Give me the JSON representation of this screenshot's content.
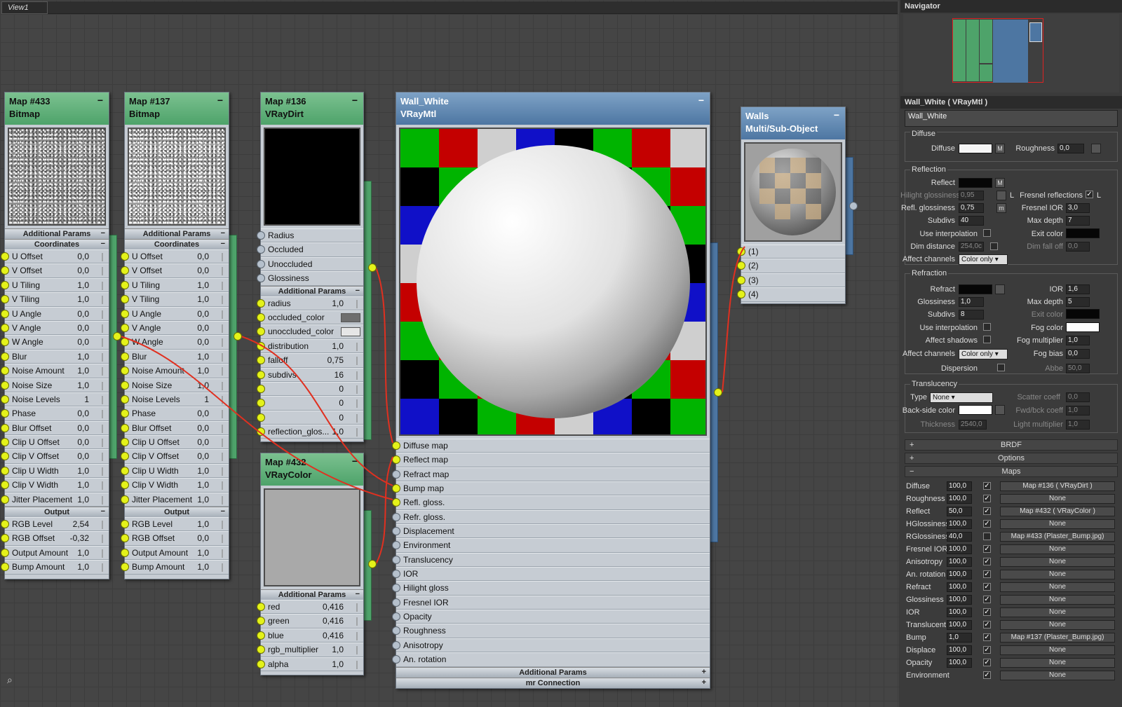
{
  "view": {
    "tab": "View1"
  },
  "nodes": {
    "n433": {
      "title": "Map #433",
      "type": "Bitmap",
      "sec1": "Additional Params",
      "sec2": "Coordinates",
      "sec3": "Output",
      "coords": [
        [
          "U Offset",
          "0,0"
        ],
        [
          "V Offset",
          "0,0"
        ],
        [
          "U Tiling",
          "1,0"
        ],
        [
          "V Tiling",
          "1,0"
        ],
        [
          "U Angle",
          "0,0"
        ],
        [
          "V Angle",
          "0,0"
        ],
        [
          "W Angle",
          "0,0"
        ],
        [
          "Blur",
          "1,0"
        ],
        [
          "Noise Amount",
          "1,0"
        ],
        [
          "Noise Size",
          "1,0"
        ],
        [
          "Noise Levels",
          "1"
        ],
        [
          "Phase",
          "0,0"
        ],
        [
          "Blur Offset",
          "0,0"
        ],
        [
          "Clip U Offset",
          "0,0"
        ],
        [
          "Clip V Offset",
          "0,0"
        ],
        [
          "Clip U Width",
          "1,0"
        ],
        [
          "Clip V Width",
          "1,0"
        ],
        [
          "Jitter Placement",
          "1,0"
        ]
      ],
      "output": [
        [
          "RGB Level",
          "2,54"
        ],
        [
          "RGB Offset",
          "-0,32"
        ],
        [
          "Output Amount",
          "1,0"
        ],
        [
          "Bump Amount",
          "1,0"
        ]
      ]
    },
    "n137": {
      "title": "Map #137",
      "type": "Bitmap",
      "sec1": "Additional Params",
      "sec2": "Coordinates",
      "sec3": "Output",
      "coords": [
        [
          "U Offset",
          "0,0"
        ],
        [
          "V Offset",
          "0,0"
        ],
        [
          "U Tiling",
          "1,0"
        ],
        [
          "V Tiling",
          "1,0"
        ],
        [
          "U Angle",
          "0,0"
        ],
        [
          "V Angle",
          "0,0"
        ],
        [
          "W Angle",
          "0,0"
        ],
        [
          "Blur",
          "1,0"
        ],
        [
          "Noise Amount",
          "1,0"
        ],
        [
          "Noise Size",
          "1,0"
        ],
        [
          "Noise Levels",
          "1"
        ],
        [
          "Phase",
          "0,0"
        ],
        [
          "Blur Offset",
          "0,0"
        ],
        [
          "Clip U Offset",
          "0,0"
        ],
        [
          "Clip V Offset",
          "0,0"
        ],
        [
          "Clip U Width",
          "1,0"
        ],
        [
          "Clip V Width",
          "1,0"
        ],
        [
          "Jitter Placement",
          "1,0"
        ]
      ],
      "output": [
        [
          "RGB Level",
          "1,0"
        ],
        [
          "RGB Offset",
          "0,0"
        ],
        [
          "Output Amount",
          "1,0"
        ],
        [
          "Bump Amount",
          "1,0"
        ]
      ]
    },
    "n136": {
      "title": "Map #136",
      "type": "VRayDirt",
      "inputs": [
        "Radius",
        "Occluded",
        "Unoccluded",
        "Glossiness"
      ],
      "sec1": "Additional Params",
      "params": [
        [
          "radius",
          "1,0"
        ],
        [
          "occluded_color",
          ""
        ],
        [
          "unoccluded_color",
          ""
        ],
        [
          "distribution",
          "1,0"
        ],
        [
          "falloff",
          "0,75"
        ],
        [
          "subdivs",
          "16"
        ],
        [
          "",
          "0"
        ],
        [
          "",
          "0"
        ],
        [
          "",
          "0"
        ],
        [
          "reflection_glos...",
          "1,0"
        ]
      ]
    },
    "n432": {
      "title": "Map #432",
      "type": "VRayColor",
      "sec1": "Additional Params",
      "params": [
        [
          "red",
          "0,416"
        ],
        [
          "green",
          "0,416"
        ],
        [
          "blue",
          "0,416"
        ],
        [
          "rgb_multiplier",
          "1,0"
        ],
        [
          "alpha",
          "1,0"
        ]
      ]
    },
    "wall": {
      "title": "Wall_White",
      "type": "VRayMtl",
      "slots": [
        "Diffuse map",
        "Reflect map",
        "Refract map",
        "Bump map",
        "Refl. gloss.",
        "Refr. gloss.",
        "Displacement",
        "Environment",
        "Translucency",
        "IOR",
        "Hilight gloss",
        "Fresnel IOR",
        "Opacity",
        "Roughness",
        "Anisotropy",
        "An. rotation"
      ],
      "sec1": "Additional Params",
      "sec2": "mr Connection"
    },
    "walls": {
      "title": "Walls",
      "type": "Multi/Sub-Object",
      "slots": [
        "(1)",
        "(2)",
        "(3)",
        "(4)"
      ]
    }
  },
  "navigator": {
    "title": "Navigator"
  },
  "material": {
    "header": "Wall_White  ( VRayMtl )",
    "name": "Wall_White",
    "diffuse": {
      "label": "Diffuse",
      "group": "Diffuse",
      "m": "M",
      "roughness_label": "Roughness",
      "roughness": "0,0"
    },
    "reflection": {
      "group": "Reflection",
      "reflect": "Reflect",
      "m": "M",
      "hilight": "Hilight glossiness",
      "hilight_val": "0,95",
      "l": "L",
      "fresnel": "Fresnel reflections",
      "fresnel_l": "L",
      "refl_gloss": "Refl. glossiness",
      "refl_gloss_val": "0,75",
      "mm": "m",
      "fresnel_ior": "Fresnel IOR",
      "fresnel_ior_val": "3,0",
      "subdivs": "Subdivs",
      "subdivs_val": "40",
      "max_depth": "Max depth",
      "max_depth_val": "7",
      "use_interp": "Use interpolation",
      "exit_color": "Exit color",
      "dim_dist": "Dim distance",
      "dim_dist_val": "254,0c",
      "dim_falloff": "Dim fall off",
      "dim_falloff_val": "0,0",
      "affect": "Affect channels",
      "affect_val": "Color only"
    },
    "refraction": {
      "group": "Refraction",
      "refract": "Refract",
      "ior": "IOR",
      "ior_val": "1,6",
      "gloss": "Glossiness",
      "gloss_val": "1,0",
      "max_depth": "Max depth",
      "max_depth_val": "5",
      "subdivs": "Subdivs",
      "subdivs_val": "8",
      "exit_color": "Exit color",
      "use_interp": "Use interpolation",
      "fog_color": "Fog color",
      "affect_shadows": "Affect shadows",
      "fog_mult": "Fog multiplier",
      "fog_mult_val": "1,0",
      "affect": "Affect channels",
      "affect_val": "Color only",
      "fog_bias": "Fog bias",
      "fog_bias_val": "0,0",
      "dispersion": "Dispersion",
      "abbe": "Abbe",
      "abbe_val": "50,0"
    },
    "translucency": {
      "group": "Translucency",
      "type": "Type",
      "type_val": "None",
      "scatter": "Scatter coeff",
      "scatter_val": "0,0",
      "backside": "Back-side color",
      "fwd": "Fwd/bck coeff",
      "fwd_val": "1,0",
      "thickness": "Thickness",
      "thickness_val": "2540,0",
      "light_mult": "Light multiplier",
      "light_mult_val": "1,0"
    },
    "rollouts": [
      "BRDF",
      "Options",
      "Maps"
    ],
    "maps": [
      [
        "Diffuse",
        "100,0",
        true,
        "Map #136  ( VRayDirt )"
      ],
      [
        "Roughness",
        "100,0",
        true,
        "None"
      ],
      [
        "Reflect",
        "50,0",
        true,
        "Map #432  ( VRayColor )"
      ],
      [
        "HGlossiness",
        "100,0",
        true,
        "None"
      ],
      [
        "RGlossiness",
        "40,0",
        false,
        "Map #433 (Plaster_Bump.jpg)"
      ],
      [
        "Fresnel IOR",
        "100,0",
        true,
        "None"
      ],
      [
        "Anisotropy",
        "100,0",
        true,
        "None"
      ],
      [
        "An. rotation",
        "100,0",
        true,
        "None"
      ],
      [
        "Refract",
        "100,0",
        true,
        "None"
      ],
      [
        "Glossiness",
        "100,0",
        true,
        "None"
      ],
      [
        "IOR",
        "100,0",
        true,
        "None"
      ],
      [
        "Translucent",
        "100,0",
        true,
        "None"
      ],
      [
        "Bump",
        "1,0",
        true,
        "Map #137 (Plaster_Bump.jpg)"
      ],
      [
        "Displace",
        "100,0",
        true,
        "None"
      ],
      [
        "Opacity",
        "100,0",
        true,
        "None"
      ],
      [
        "Environment",
        "",
        true,
        "None"
      ]
    ]
  },
  "colors": {
    "node_green": "#4ea36a",
    "node_blue": "#4d76a2",
    "wire": "#e03020",
    "socket": "#e4f21a"
  },
  "icons": {
    "binoculars": "binoculars-icon"
  }
}
